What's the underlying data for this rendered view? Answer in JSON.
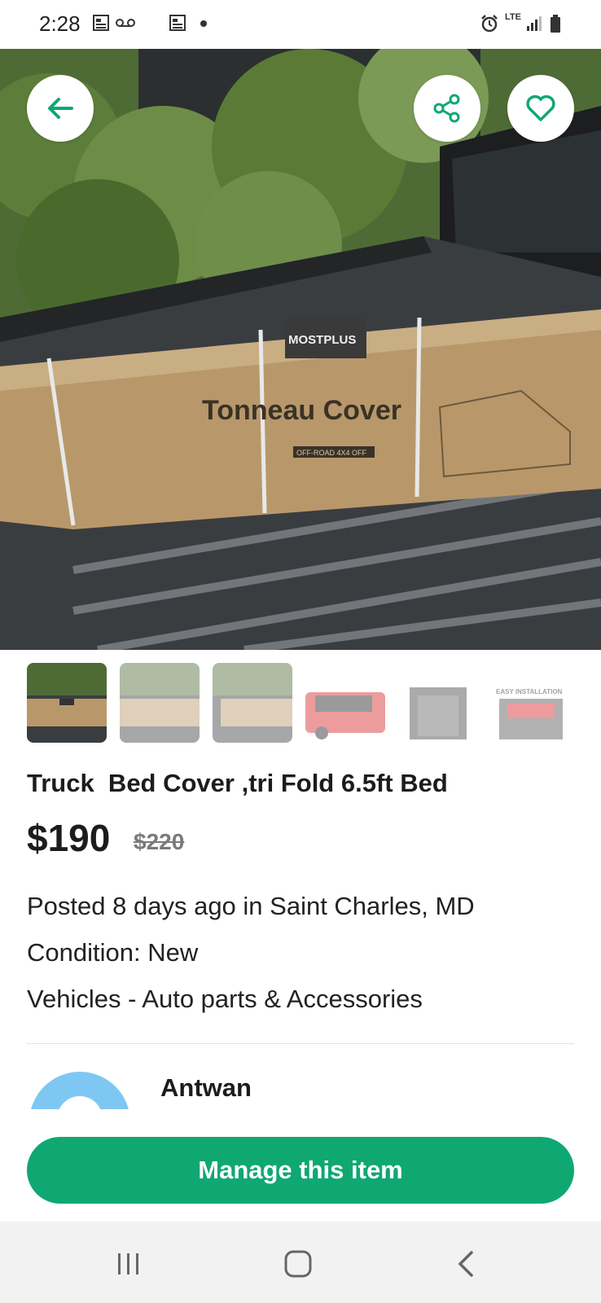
{
  "status_bar": {
    "time": "2:28",
    "network": "LTE",
    "icons": [
      "news-icon",
      "voicemail-icon",
      "news-icon",
      "dot-icon",
      "alarm-icon",
      "lte-icon",
      "signal-icon",
      "battery-icon"
    ]
  },
  "hero": {
    "box_brand": "MOSTPLUS",
    "box_title": "Tonneau Cover",
    "box_tag": "OFF-ROAD 4X4 OFF",
    "actions": [
      "back-arrow-icon",
      "share-icon",
      "heart-icon"
    ]
  },
  "thumbnails": {
    "count": 6,
    "selected_index": 0,
    "last_caption": "EASY INSTALLATION"
  },
  "listing": {
    "title": "Truck  Bed Cover ,tri Fold 6.5ft Bed",
    "price": "$190",
    "original_price": "$220",
    "posted": "Posted 8 days ago in Saint Charles, MD",
    "condition": "Condition: New",
    "category": "Vehicles - Auto parts & Accessories"
  },
  "seller": {
    "name": "Antwan"
  },
  "cta": {
    "label": "Manage this item"
  },
  "colors": {
    "accent": "#0fa872",
    "avatar": "#7fc7f3",
    "strike_price": "#7a7a7a"
  }
}
